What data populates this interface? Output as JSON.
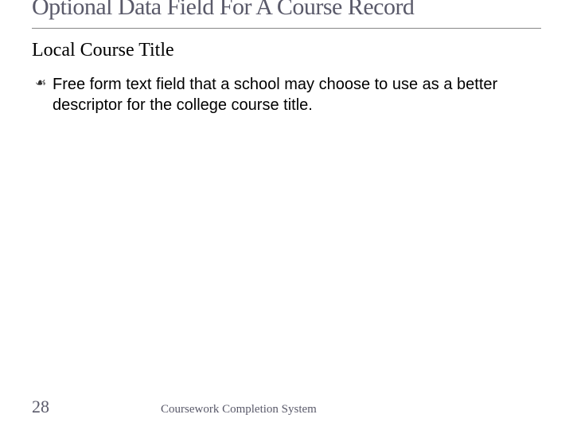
{
  "slide": {
    "title": "Optional Data Field For A Course Record",
    "subheading": "Local Course Title",
    "bullet": "Free form text field that a school may choose to use as a better descriptor for the college course title."
  },
  "footer": {
    "page_number": "28",
    "label": "Coursework Completion System"
  }
}
